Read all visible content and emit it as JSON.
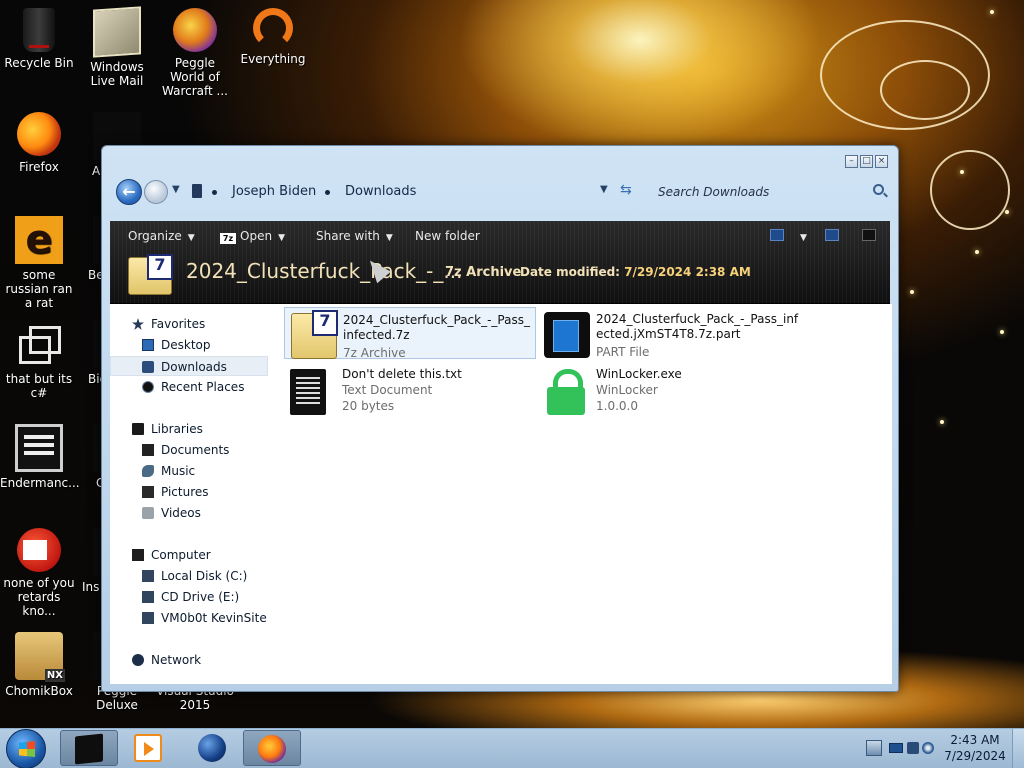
{
  "desktop": {
    "icons": [
      {
        "label": "Recycle Bin",
        "icon": "recycle-bin-icon"
      },
      {
        "label": "Windows Live Mail",
        "icon": "windows-live-mail-icon"
      },
      {
        "label": "Peggle World of Warcraft ...",
        "icon": "peggle-icon"
      },
      {
        "label": "Everything",
        "icon": "everything-icon"
      },
      {
        "label": "Firefox",
        "icon": "firefox-icon"
      },
      {
        "label": "some russian ran a rat",
        "icon": "e-letter-icon"
      },
      {
        "label": "that but its c#",
        "icon": "windows-shortcut-icon"
      },
      {
        "label": "Endermanc...",
        "icon": "terminal-icon"
      },
      {
        "label": "none of you retards kno...",
        "icon": "red-circle-icon"
      },
      {
        "label": "ChomikBox",
        "icon": "chomikbox-icon"
      },
      {
        "label": "Visual Studio 2015",
        "icon": "visual-studio-icon"
      }
    ],
    "partial_labels": [
      "A",
      "Be",
      "Big",
      "C",
      "Ins",
      "Peggle Deluxe"
    ]
  },
  "window": {
    "breadcrumb": [
      "Joseph Biden",
      "Downloads"
    ],
    "search_placeholder": "Search Downloads",
    "toolbar": {
      "organize": "Organize",
      "open": "Open",
      "share_with": "Share with",
      "new_folder": "New folder"
    },
    "details": {
      "name": "2024_Clusterfuck_Pack_-_...",
      "type": "7z Archive",
      "modified_label": "Date modified:",
      "modified_value": "7/29/2024 2:38 AM"
    },
    "nav": {
      "favorites": "Favorites",
      "desktop": "Desktop",
      "downloads": "Downloads",
      "recent": "Recent Places",
      "libraries": "Libraries",
      "documents": "Documents",
      "music": "Music",
      "pictures": "Pictures",
      "videos": "Videos",
      "computer": "Computer",
      "local_disk": "Local Disk (C:)",
      "cd_drive": "CD Drive (E:)",
      "share": "VM0b0t KevinSite",
      "network": "Network"
    },
    "files": [
      {
        "name": "2024_Clusterfuck_Pack_-_Pass_infected.7z",
        "type": "7z Archive",
        "extra": ""
      },
      {
        "name": "2024_Clusterfuck_Pack_-_Pass_infected.jXmST4T8.7z.part",
        "type": "PART File",
        "extra": ""
      },
      {
        "name": "Don't delete this.txt",
        "type": "Text Document",
        "extra": "20 bytes"
      },
      {
        "name": "WinLocker.exe",
        "type": "WinLocker",
        "extra": "1.0.0.0"
      }
    ]
  },
  "taskbar": {
    "time": "2:43 AM",
    "date": "7/29/2024"
  }
}
